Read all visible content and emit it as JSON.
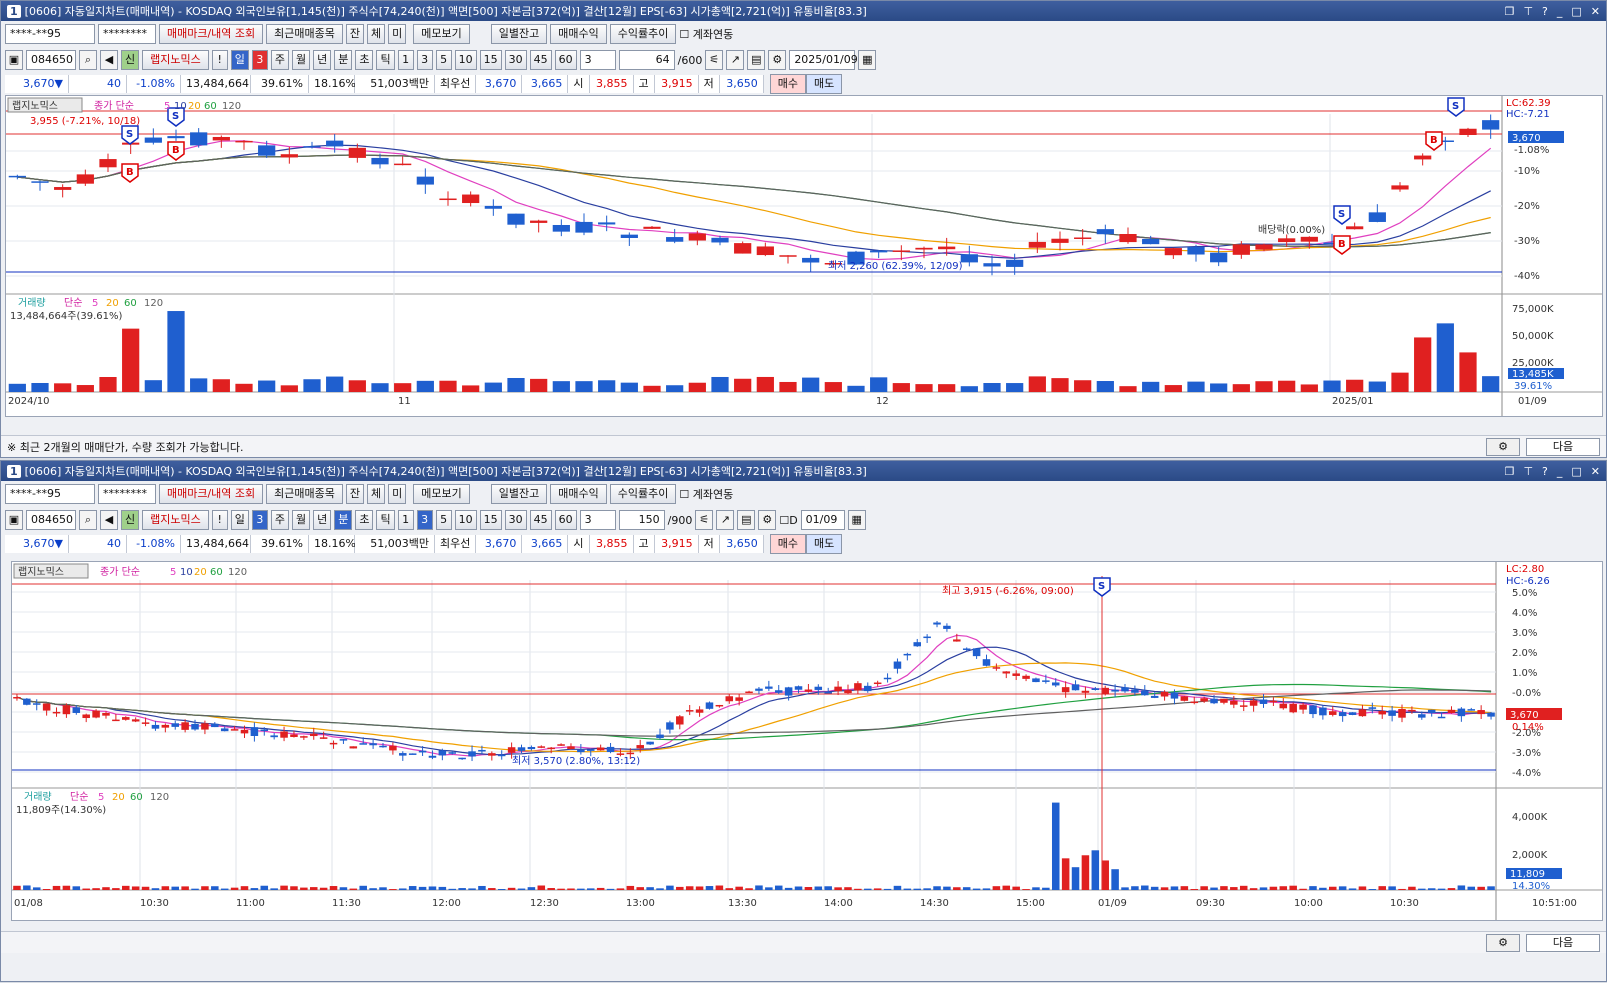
{
  "top": {
    "title": "[0606] 자동일지차트(매매내역) - KOSDAQ 외국인보유[1,145(천)] 주식수[74,240(천)] 액면[500] 자본금[372(억)] 결산[12월] EPS[-63] 시가총액[2,721(억)] 유통비율[83.3]",
    "account": "****-**95",
    "password": "********",
    "btn_trade_mark": "매매마크/내역 조회",
    "btn_recent": "최근매매종목",
    "btn_jan": "잔",
    "btn_che": "체",
    "btn_mi": "미",
    "btn_memo": "메모보기",
    "btn_daily": "일별잔고",
    "btn_profit": "매매수익",
    "btn_rate": "수익률추이",
    "chk_link": "계좌연동",
    "code": "084650",
    "shin": "신",
    "stock_name": "랩지노믹스",
    "excl": "!",
    "periods": [
      "일",
      "3",
      "주",
      "월",
      "년",
      "분",
      "초",
      "틱"
    ],
    "nums": [
      "1",
      "3",
      "5",
      "10",
      "15",
      "30",
      "45",
      "60"
    ],
    "interval": "3",
    "count": "64",
    "count_max": "/600",
    "date": "2025/01/09",
    "status_text": "※   최근 2개월의 매매단가, 수량 조회가 가능합니다.",
    "next": "다음"
  },
  "quote": {
    "price": "3,670▼",
    "change": "40",
    "rate": "-1.08%",
    "volume": "13,484,664",
    "turnover": "39.61%",
    "pct2": "18.16%",
    "amount": "51,003백만",
    "best_label": "최우선",
    "ask": "3,670",
    "bid": "3,665",
    "open_label": "시",
    "open": "3,855",
    "high_label": "고",
    "high": "3,915",
    "low_label": "저",
    "low": "3,650",
    "buy": "매수",
    "sell": "매도"
  },
  "top_chart": {
    "legend_name": "랩지노믹스",
    "legend_ma": "종가 단순",
    "ma_periods": [
      "5",
      "10",
      "20",
      "60",
      "120"
    ],
    "hi_note": "3,955 (-7.21%, 10/18)",
    "lo_note": "최저 2,260 (62.39%, 12/09)",
    "div_note": "배당락(0.00%)",
    "right_lc": "LC:62.39",
    "right_hc": "HC:-7.21",
    "right_price": "3,670",
    "pct_ticks": [
      "-1.08%",
      "-10%",
      "-20%",
      "-30%",
      "-40%"
    ],
    "vol_legend": "거래량",
    "vol_ma": "단순",
    "vol_ma_periods": [
      "5",
      "20",
      "60",
      "120"
    ],
    "vol_note": "13,484,664주(39.61%)",
    "vol_ticks": [
      "75,000K",
      "50,000K",
      "25,000K"
    ],
    "vol_cur": "13,485K",
    "vol_pct": "39.61%",
    "x_labels": [
      "2024/10",
      "11",
      "12",
      "2025/01",
      "01/09"
    ]
  },
  "bottom": {
    "title": "[0606] 자동일지차트(매매내역) - KOSDAQ 외국인보유[1,145(천)] 주식수[74,240(천)] 액면[500] 자본금[372(억)] 결산[12월] EPS[-63] 시가총액[2,721(억)] 유통비율[83.3]",
    "count": "150",
    "count_max": "/900",
    "d_label": "D",
    "date": "01/09"
  },
  "bottom_chart": {
    "hi_note": "최고 3,915 (-6.26%, 09:00)",
    "lo_note": "최저 3,570 (2.80%, 13:12)",
    "right_lc": "LC:2.80",
    "right_hc": "HC:-6.26",
    "right_price": "3,670",
    "right_pct": "0.14%",
    "pct_ticks": [
      "5.0%",
      "4.0%",
      "3.0%",
      "2.0%",
      "1.0%",
      "-0.0%",
      "-1.0%",
      "-2.0%",
      "-3.0%",
      "-4.0%"
    ],
    "vol_note": "11,809주(14.30%)",
    "vol_ticks": [
      "4,000K",
      "2,000K"
    ],
    "vol_cur": "11,809",
    "vol_pct": "14.30%",
    "x_labels": [
      "01/08",
      "10:30",
      "11:00",
      "11:30",
      "12:00",
      "12:30",
      "13:00",
      "13:30",
      "14:00",
      "14:30",
      "15:00",
      "01/09",
      "09:30",
      "10:00",
      "10:30",
      "10:51:00"
    ]
  },
  "colors": {
    "up": "#e02020",
    "down": "#1f5fcf",
    "ma5": "#e040c0",
    "ma10": "#2a3fa0",
    "ma20": "#f0a000",
    "ma60": "#20a040",
    "ma120": "#606060"
  }
}
